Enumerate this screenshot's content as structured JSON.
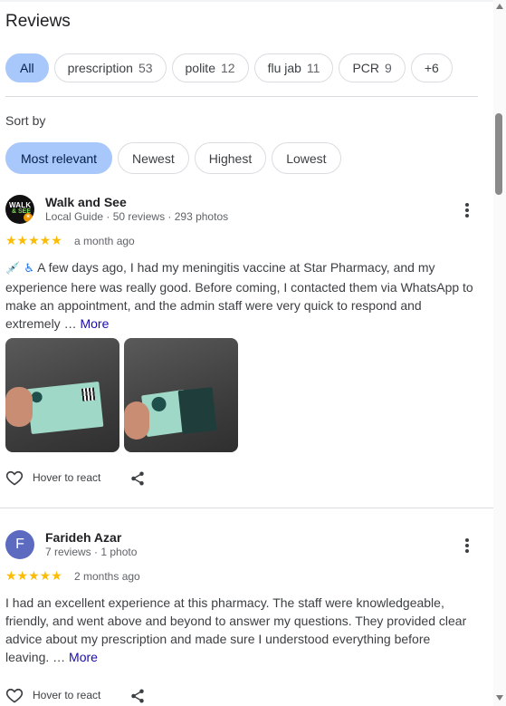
{
  "header": {
    "title": "Reviews"
  },
  "filters": [
    {
      "label": "All",
      "count": null,
      "selected": true
    },
    {
      "label": "prescription",
      "count": "53",
      "selected": false
    },
    {
      "label": "polite",
      "count": "12",
      "selected": false
    },
    {
      "label": "flu jab",
      "count": "11",
      "selected": false
    },
    {
      "label": "PCR",
      "count": "9",
      "selected": false
    },
    {
      "label": "+6",
      "count": null,
      "selected": false
    }
  ],
  "sort": {
    "label": "Sort by",
    "options": [
      "Most relevant",
      "Newest",
      "Highest",
      "Lowest"
    ],
    "selected": "Most relevant"
  },
  "reviews": [
    {
      "name": "Walk and See",
      "meta": "Local Guide · 50 reviews · 293 photos",
      "avatar_text_1": "WALK",
      "avatar_text_2": "& SEE",
      "rating": 5,
      "stars": "★★★★★",
      "ago": "a month ago",
      "emoji": "💉 ♿",
      "text": "A few days ago, I had my meningitis vaccine at Star Pharmacy, and my experience here was really good. Before coming, I contacted them via WhatsApp to make an appointment, and the admin staff were very quick to respond and extremely … ",
      "more": "More",
      "react_label": "Hover to react",
      "photo_count": 2
    },
    {
      "name": "Farideh Azar",
      "meta": "7 reviews · 1 photo",
      "avatar_letter": "F",
      "rating": 5,
      "stars": "★★★★★",
      "ago": "2 months ago",
      "text": "I had an excellent experience at this pharmacy. The staff were knowledgeable, friendly, and went above and beyond to answer my questions. They provided clear advice about my prescription and made sure I understood everything before leaving. … ",
      "more": "More",
      "react_label": "Hover to react"
    }
  ],
  "colors": {
    "accent_chip": "#a8c7fa",
    "star": "#fbbc04",
    "link": "#1a0dab",
    "avatar_letter_bg": "#5c6bc0"
  },
  "icons": [
    "kebab-menu-icon",
    "heart-outline-icon",
    "share-icon",
    "scroll-up-icon",
    "scroll-down-icon"
  ]
}
